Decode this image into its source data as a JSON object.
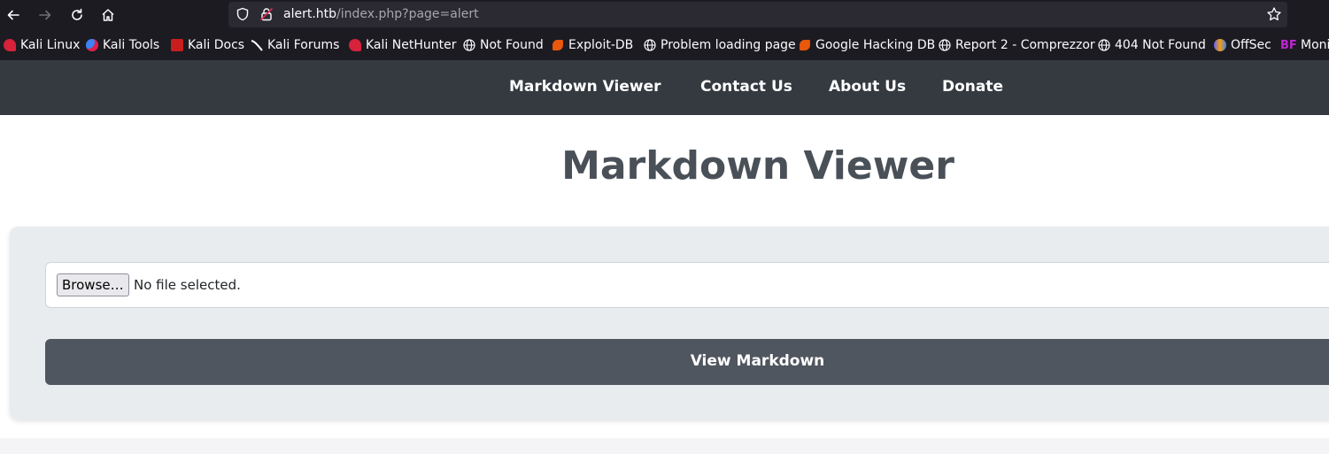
{
  "browser": {
    "url_host": "alert.htb",
    "url_path": "/index.php?page=alert"
  },
  "bookmarks": [
    {
      "label": "Kali Linux",
      "icon": "kali-icon"
    },
    {
      "label": "Kali Tools",
      "icon": "kali-tools-icon"
    },
    {
      "label": "Kali Docs",
      "icon": "kali-docs-icon"
    },
    {
      "label": "Kali Forums",
      "icon": "kali-forums-icon"
    },
    {
      "label": "Kali NetHunter",
      "icon": "kali-icon"
    },
    {
      "label": "Not Found",
      "icon": "globe-icon"
    },
    {
      "label": "Exploit-DB",
      "icon": "exploit-db-icon"
    },
    {
      "label": "Problem loading page",
      "icon": "globe-icon"
    },
    {
      "label": "Google Hacking DB",
      "icon": "exploit-db-icon"
    },
    {
      "label": "Report 2 - Comprezzor",
      "icon": "globe-icon"
    },
    {
      "label": "404 Not Found",
      "icon": "globe-icon"
    },
    {
      "label": "OffSec",
      "icon": "offsec-icon"
    },
    {
      "label": "Moni",
      "icon": "bf-icon"
    }
  ],
  "site_nav": {
    "items": [
      "Markdown Viewer",
      "Contact Us",
      "About Us",
      "Donate"
    ]
  },
  "main": {
    "title": "Markdown Viewer",
    "browse_label": "Browse…",
    "file_status": "No file selected.",
    "submit_label": "View Markdown"
  },
  "colors": {
    "header_bg": "#343a40",
    "card_bg": "#e9ecef",
    "button_bg": "#50565f",
    "title_color": "#495057"
  }
}
